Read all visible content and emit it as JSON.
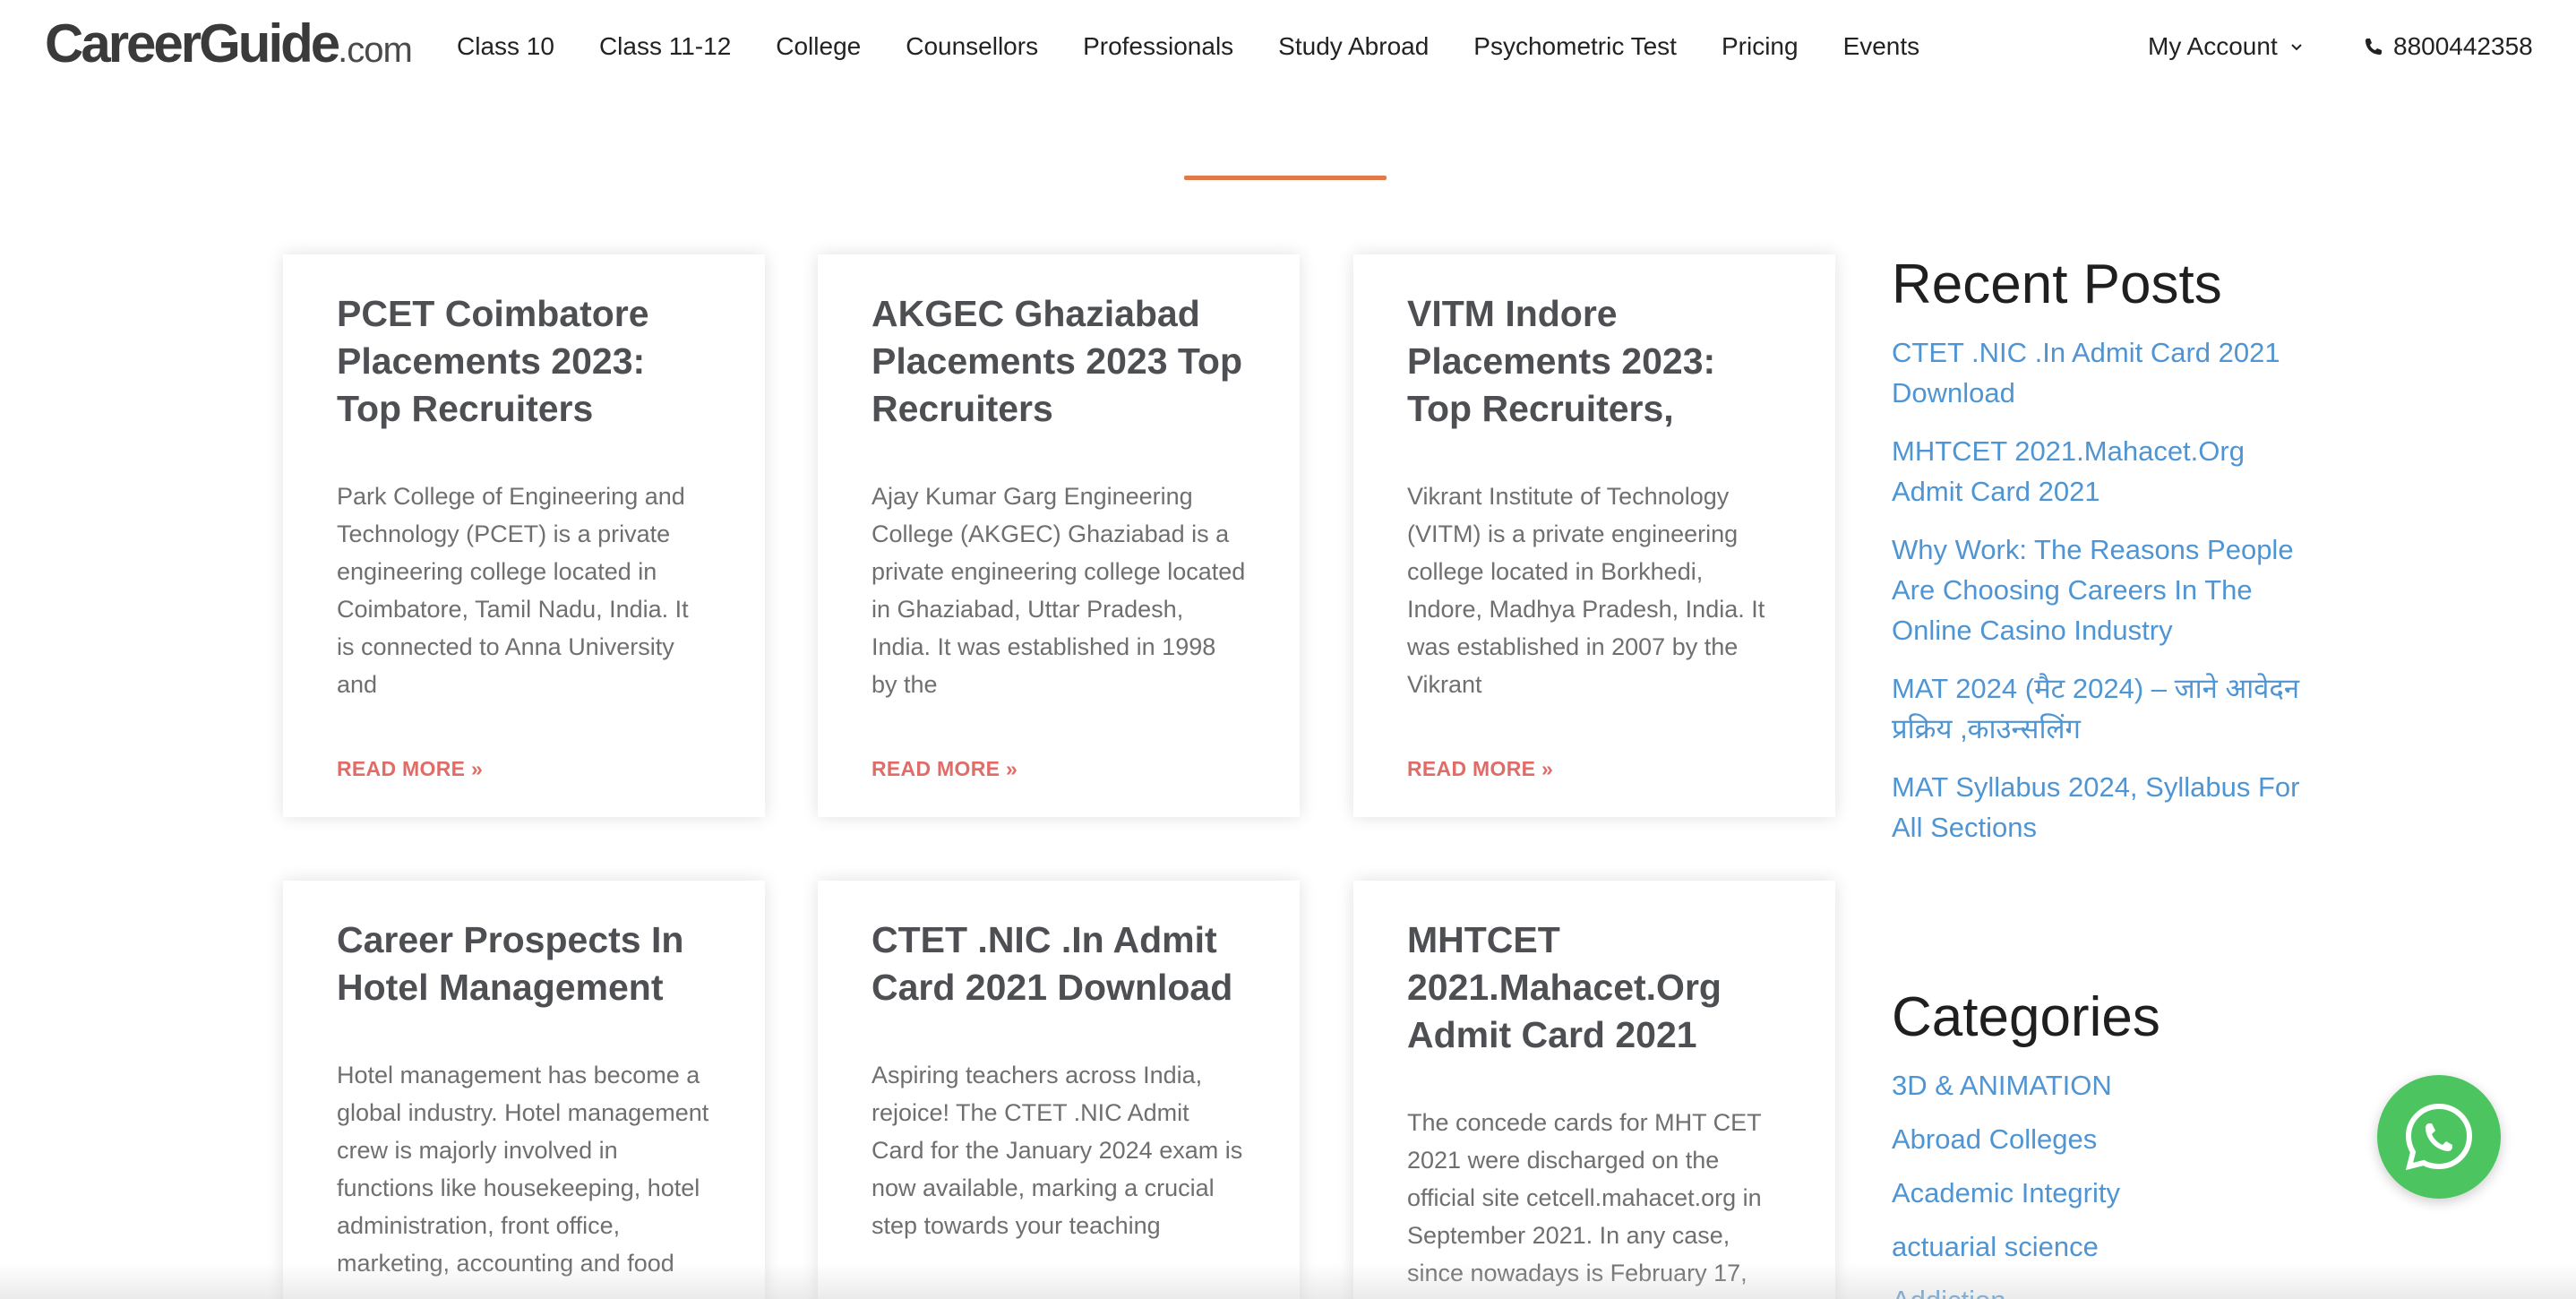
{
  "header": {
    "logo_main": "CareerGuide",
    "logo_tld": ".com",
    "nav": [
      "Class 10",
      "Class 11-12",
      "College",
      "Counsellors",
      "Professionals",
      "Study Abroad",
      "Psychometric Test",
      "Pricing",
      "Events"
    ],
    "account_label": "My Account",
    "phone": "8800442358"
  },
  "cards": [
    {
      "title": "PCET Coimbatore Placements 2023: Top Recruiters",
      "excerpt": "Park College of Engineering and Technology (PCET) is a private engineering college located in Coimbatore, Tamil Nadu, India. It is connected to Anna University and",
      "read_more": "READ MORE »"
    },
    {
      "title": "AKGEC Ghaziabad Placements 2023 Top Recruiters",
      "excerpt": "Ajay Kumar Garg Engineering College (AKGEC) Ghaziabad is a private engineering college located in Ghaziabad, Uttar Pradesh, India. It was established in 1998 by the",
      "read_more": "READ MORE »"
    },
    {
      "title": "VITM Indore Placements 2023: Top Recruiters,",
      "excerpt": "Vikrant Institute of Technology (VITM) is a private engineering college located in Borkhedi, Indore, Madhya Pradesh, India. It was established in 2007 by the Vikrant",
      "read_more": "READ MORE »"
    },
    {
      "title": "Career Prospects In Hotel Management",
      "excerpt": "Hotel management has become a global industry. Hotel management crew is majorly involved in functions like housekeeping, hotel administration, front office, marketing, accounting and food"
    },
    {
      "title": "CTET .NIC .In Admit Card 2021 Download",
      "excerpt": "Aspiring teachers across India, rejoice! The CTET .NIC Admit Card for the January 2024 exam is now available, marking a crucial step towards your teaching"
    },
    {
      "title": "MHTCET 2021.Mahacet.Org Admit Card 2021",
      "excerpt": "The concede cards for MHT CET 2021 were discharged on the official site cetcell.mahacet.org in September 2021. In any case, since nowadays is February 17,"
    }
  ],
  "sidebar": {
    "recent_heading": "Recent Posts",
    "recent_posts": [
      "CTET .NIC .In Admit Card 2021 Download",
      "MHTCET 2021.Mahacet.Org Admit Card 2021",
      "Why Work: The Reasons People Are Choosing Careers In The Online Casino Industry",
      "MAT 2024 (मैट 2024) – जाने आवेदन प्रक्रिय ,काउन्सलिंग",
      "MAT Syllabus 2024, Syllabus For All Sections"
    ],
    "categories_heading": "Categories",
    "categories": [
      "3D & ANIMATION",
      "Abroad Colleges",
      "Academic Integrity",
      "actuarial science",
      "Addiction"
    ]
  },
  "colors": {
    "accent": "#e07a4a",
    "link": "#4f95d3",
    "read_more": "#e06b67",
    "whatsapp": "#4cc561"
  },
  "icons": {
    "account": "chevron-down-icon",
    "phone": "phone-icon",
    "chat": "whatsapp-icon"
  }
}
